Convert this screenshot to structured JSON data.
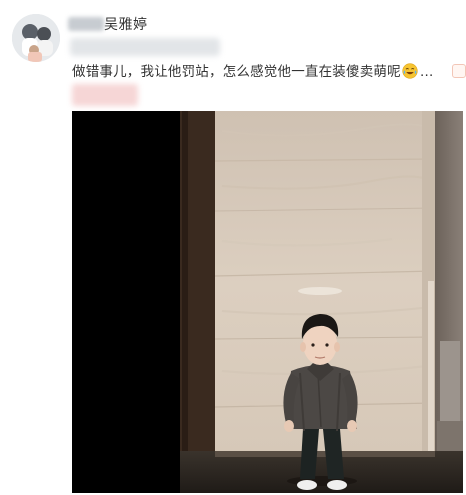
{
  "post": {
    "username": "吴雅婷",
    "text": "做错事儿，我让他罚站，怎么感觉他一直在装傻卖萌呢",
    "ellipsis": "…",
    "emoji": "laughing-tears-icon"
  },
  "photo": {
    "description_icon": "toddler-standing-photo"
  },
  "colors": {
    "text": "#333333",
    "background": "#ffffff",
    "wall": "#d8cbbd",
    "photo_left": "#000000"
  }
}
